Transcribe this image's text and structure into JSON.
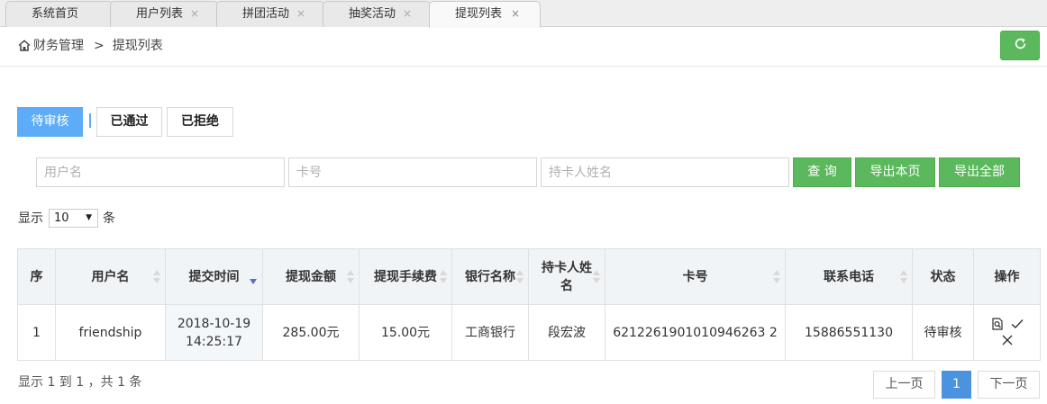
{
  "tabs": [
    {
      "label": "系统首页"
    },
    {
      "label": "用户列表",
      "close": "×"
    },
    {
      "label": "拼团活动",
      "close": "×"
    },
    {
      "label": "抽奖活动",
      "close": "×"
    },
    {
      "label": "提现列表",
      "close": "×"
    }
  ],
  "breadcrumb": {
    "parent": "财务管理",
    "separator": ">",
    "current": "提现列表"
  },
  "status_filter": {
    "pending": "待审核",
    "approved": "已通过",
    "rejected": "已拒绝",
    "selected": "待审核"
  },
  "search": {
    "username_placeholder": "用户名",
    "card_placeholder": "卡号",
    "holder_placeholder": "持卡人姓名",
    "query_label": "查 询",
    "export_page_label": "导出本页",
    "export_all_label": "导出全部"
  },
  "page_size": {
    "prefix": "显示",
    "value": "10",
    "suffix": "条"
  },
  "table": {
    "headers": [
      "序",
      "用户名",
      "提交时间",
      "提现金额",
      "提现手续费",
      "银行名称",
      "持卡人姓名",
      "卡号",
      "联系电话",
      "状态",
      "操作"
    ],
    "rows": [
      {
        "index": "1",
        "username": "friendship",
        "time_date": "2018-10-19",
        "time_clock": "14:25:17",
        "amount": "285.00元",
        "fee": "15.00元",
        "bank": "工商银行",
        "holder": "段宏波",
        "card": "6212261901010946263 2",
        "phone": "15886551130",
        "status": "待审核"
      }
    ]
  },
  "pagination": {
    "info": "显示 1 到 1 ，共 1 条",
    "prev": "上一页",
    "current": "1",
    "next": "下一页"
  },
  "colors": {
    "green": "#5cb85c",
    "blue_tab": "#5cacf7",
    "page_active": "#4b93de",
    "status_pending": "#e82b2b"
  },
  "icons": [
    "home-icon",
    "refresh-icon",
    "tab-close-icon",
    "view-icon",
    "approve-icon",
    "reject-icon",
    "sort-icon",
    "sort-desc-icon",
    "select-caret-icon"
  ]
}
